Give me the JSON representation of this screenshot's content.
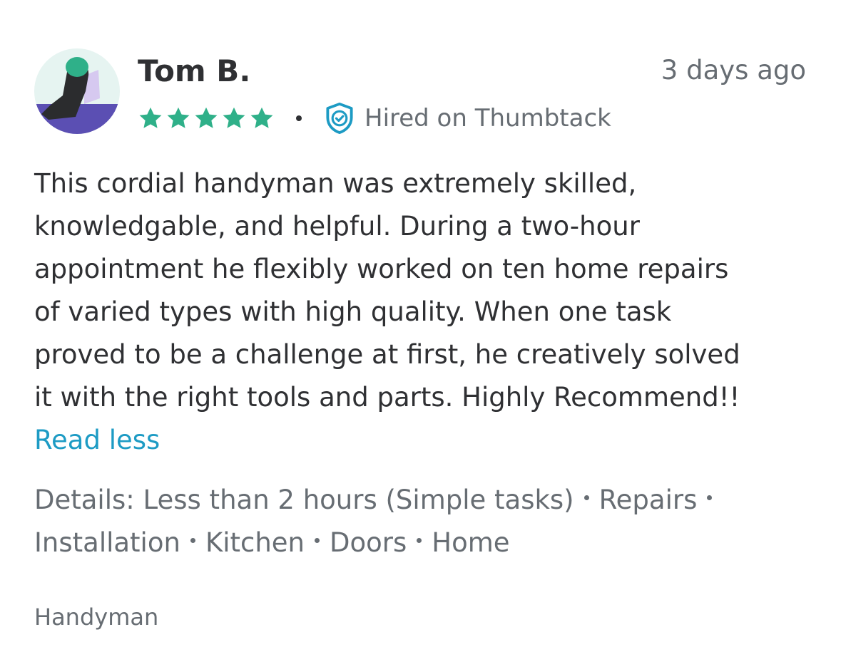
{
  "reviewer": {
    "name": "Tom B.",
    "avatar_icon": "avatar-illustration-icon",
    "rating": 5,
    "rating_max": 5
  },
  "timestamp": "3 days ago",
  "hired_badge": {
    "label": "Hired on Thumbtack",
    "icon": "shield-check-icon"
  },
  "review": {
    "lines": [
      "This cordial handyman was extremely skilled,",
      "knowledgable, and helpful. During a two-hour",
      "appointment he flexibly worked on ten home repairs",
      "of varied types with high quality. When one task",
      "proved to be a challenge at first, he creatively solved",
      "it with the right tools and parts. Highly Recommend!!"
    ],
    "toggle_label": "Read less"
  },
  "details": {
    "prefix": "Details:",
    "items": [
      "Less than 2 hours (Simple tasks)",
      "Repairs",
      "Installation",
      "Kitchen",
      "Doors",
      "Home"
    ]
  },
  "category": "Handyman",
  "colors": {
    "star": "#2fb089",
    "link": "#1d9bc4",
    "badge": "#1d9bc4",
    "text_primary": "#2f3033",
    "text_secondary": "#676d73"
  }
}
